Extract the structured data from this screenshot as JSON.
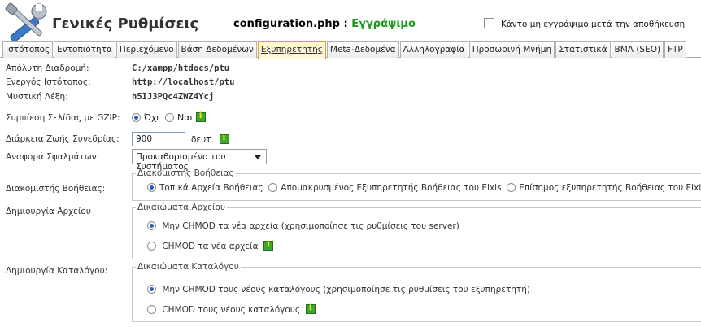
{
  "header": {
    "title": "Γενικές Ρυθμίσεις",
    "file_name": "configuration.php",
    "file_separator": " : ",
    "file_status": "Εγγράψιμο",
    "unwritable_label": "Κάντο μη εγγράψιμο μετά την αποθήκευση",
    "unwritable_checked": false,
    "status_color": "#1c9a1c"
  },
  "tabs": [
    {
      "label": "Ιστότοπος",
      "active": false
    },
    {
      "label": "Εντοπιότητα",
      "active": false
    },
    {
      "label": "Περιεχόμενο",
      "active": false
    },
    {
      "label": "Βάση Δεδομένων",
      "active": false
    },
    {
      "label": "Εξυπηρετητής",
      "active": true
    },
    {
      "label": "Meta-Δεδομένα",
      "active": false
    },
    {
      "label": "Αλληλογραφία",
      "active": false
    },
    {
      "label": "Προσωρινή Μνήμη",
      "active": false
    },
    {
      "label": "Στατιστικά",
      "active": false
    },
    {
      "label": "ΒΜΑ (SEO)",
      "active": false
    },
    {
      "label": "FTP",
      "active": false
    }
  ],
  "fields": {
    "absolute_path": {
      "label": "Απόλυτη Διαδρομή:",
      "value": "C:/xampp/htdocs/ptu"
    },
    "site_url": {
      "label": "Ενεργός Ιστότοπος:",
      "value": "http://localhost/ptu"
    },
    "secret": {
      "label": "Μυστική Λέξη:",
      "value": "h5IJ3PQc4ZWZ4Ycj"
    },
    "gzip": {
      "label": "Συμπίεση Σελίδας με GZIP:",
      "options": [
        "Όχι",
        "Ναι"
      ],
      "selected": "Όχι"
    },
    "session": {
      "label": "Διάρκεια Ζωής Συνεδρίας:",
      "value": "900",
      "unit": "δευτ."
    },
    "errors": {
      "label": "Αναφορά Σφαλμάτων:",
      "value": "Προκαθορισμένο του Συστήματος"
    }
  },
  "help_server": {
    "label": "Διακομιστής Βοήθειας:",
    "legend": "Διακομιστής Βοήθειας",
    "options": [
      "Τοπικά Αρχεία Βοήθειας",
      "Απομακρυσμένος Εξυπηρετητής Βοήθειας του Elxis",
      "Επίσημος εξυπηρετητής Βοήθειας του Elxis"
    ],
    "selected": 0
  },
  "file_creation": {
    "label": "Δημιουργία Αρχείου",
    "legend": "Δικαιώματα Αρχείου",
    "options": [
      "Μην CHMOD τα νέα αρχεία (χρησιμοποίησε τις ρυθμίσεις του server)",
      "CHMOD τα νέα αρχεία"
    ],
    "selected": 0
  },
  "dir_creation": {
    "label": "Δημιουργία Καταλόγου:",
    "legend": "Δικαιώματα Καταλόγου",
    "options": [
      "Μην CHMOD τους νέους καταλόγους (χρησιμοποίησε τις ρυθμίσεις του εξυπηρετητή)",
      "CHMOD τους νέους καταλόγους"
    ],
    "selected": 0
  },
  "icons": {
    "header": "tools-icon",
    "help": "info-icon"
  }
}
